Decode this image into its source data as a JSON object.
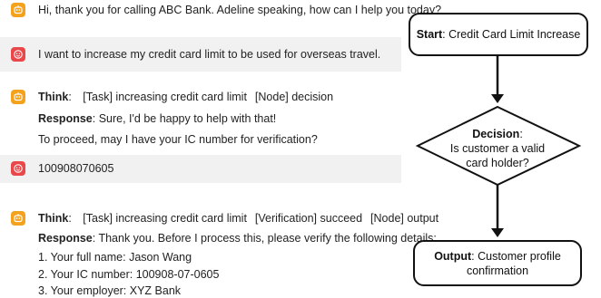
{
  "chat": {
    "m1": {
      "text": "Hi, thank you for calling ABC Bank. Adeline speaking, how can I help you today?"
    },
    "m2": {
      "text": "I want to increase my credit card limit to be used for overseas travel."
    },
    "m3": {
      "think_label": "Think",
      "think_parts": [
        ": ",
        "[Task] increasing credit card limit",
        "[Node] decision"
      ],
      "response_label": "Response",
      "response_text": ": Sure, I'd be happy to help with that!",
      "line2": "To proceed, may I have your IC number for verification?"
    },
    "m4": {
      "text": "100908070605"
    },
    "m5": {
      "think_label": "Think",
      "think_parts": [
        ": ",
        "[Task] increasing credit card limit",
        "[Verification] succeed",
        "[Node] output"
      ],
      "response_label": "Response",
      "response_text": ": Thank you. Before I process this, please verify the following details:",
      "items": [
        "1. Your full name: Jason Wang",
        "2. Your IC number: 100908-07-0605",
        "3. Your employer: XYZ Bank"
      ]
    }
  },
  "flowchart": {
    "start": {
      "label": "Start",
      "text": ": Credit Card Limit Increase"
    },
    "decision": {
      "label": "Decision",
      "line1": ":",
      "line2": "Is customer a valid",
      "line3": "card holder?"
    },
    "output": {
      "label": "Output",
      "line1": ": Customer profile",
      "line2": "confirmation"
    }
  },
  "colors": {
    "bot_avatar": "#f4a21d",
    "user_avatar": "#e9474a",
    "user_bubble": "#f1f1f1",
    "stroke": "#111111"
  },
  "icons": {
    "bot": "robot-face-icon",
    "user": "smiley-face-icon"
  }
}
